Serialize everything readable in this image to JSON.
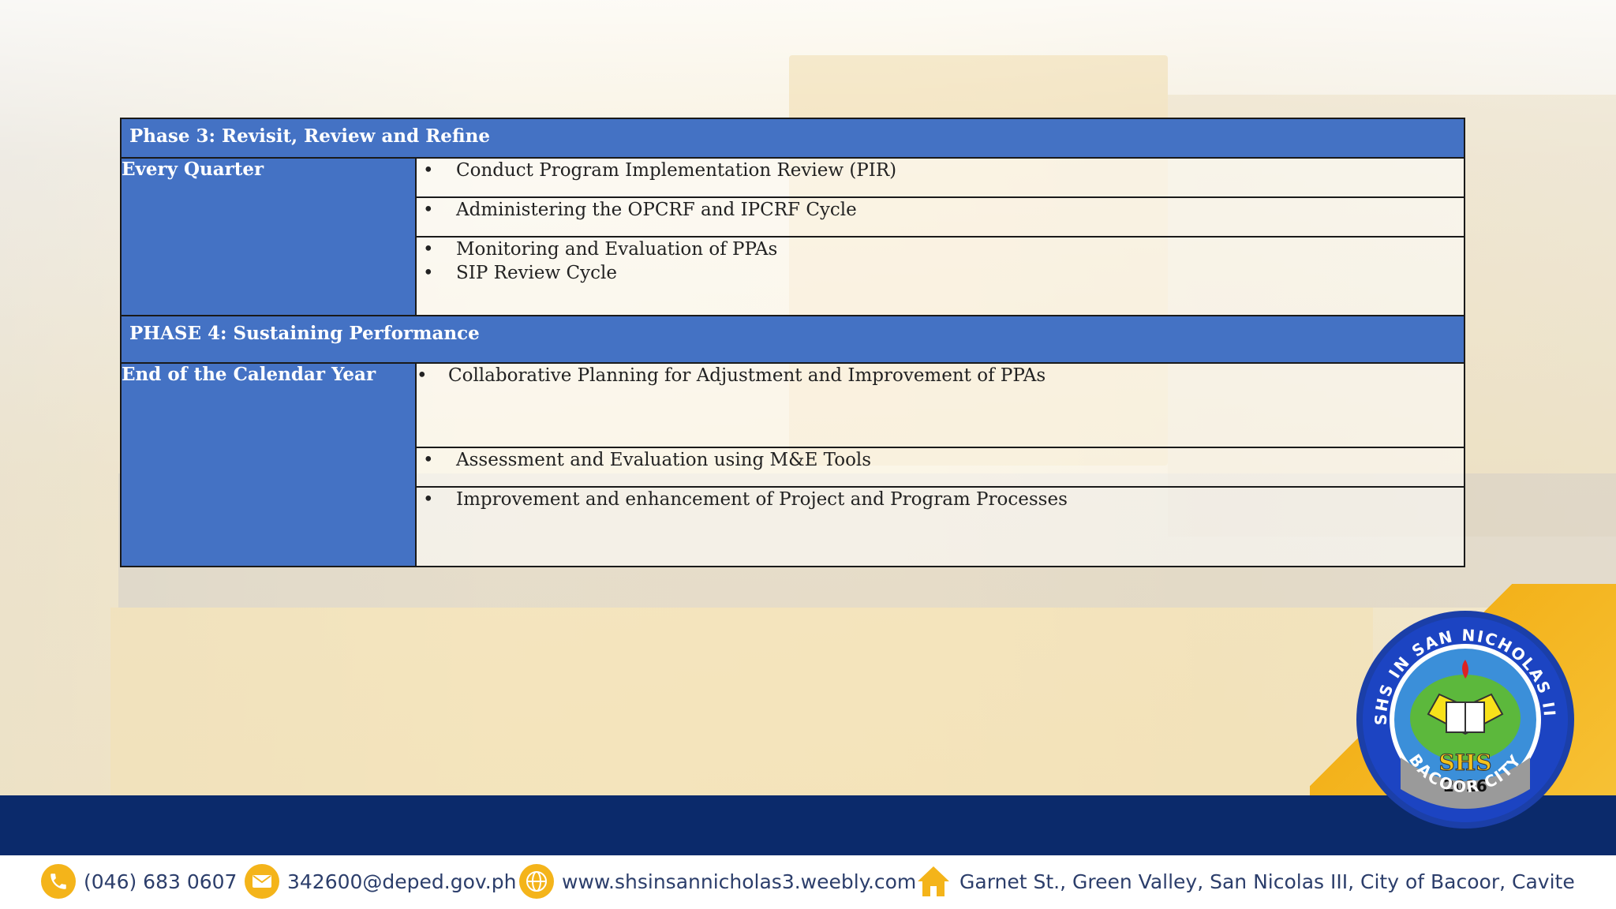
{
  "phase3": {
    "title": "Phase 3: Revisit, Review and Refine",
    "label": "Every Quarter",
    "items": [
      [
        "Conduct Program Implementation Review (PIR)"
      ],
      [
        "Administering the OPCRF and IPCRF Cycle"
      ],
      [
        "Monitoring and Evaluation of PPAs",
        "SIP Review Cycle"
      ]
    ]
  },
  "phase4": {
    "title": "PHASE 4: Sustaining Performance",
    "label": "End of the Calendar Year",
    "items": [
      [
        "Collaborative Planning for Adjustment and Improvement of PPAs"
      ],
      [
        "Assessment and Evaluation using M&E Tools"
      ],
      [
        "Improvement and enhancement of Project and Program Processes"
      ]
    ]
  },
  "bullet": "•",
  "logo": {
    "top_text": "SHS IN SAN NICHOLAS III",
    "bottom_text": "BACOOR CITY",
    "center": "SHS",
    "year": "2016"
  },
  "footer": {
    "phone": "(046) 683 0607",
    "email": "342600@deped.gov.ph",
    "website": "www.shsinsannicholas3.weebly.com",
    "address": "Garnet St., Green Valley, San Nicolas III,  City of Bacoor, Cavite"
  },
  "colors": {
    "header_blue": "#4472c4",
    "band_navy": "#0b2a6b",
    "accent_gold": "#f4b41a"
  }
}
